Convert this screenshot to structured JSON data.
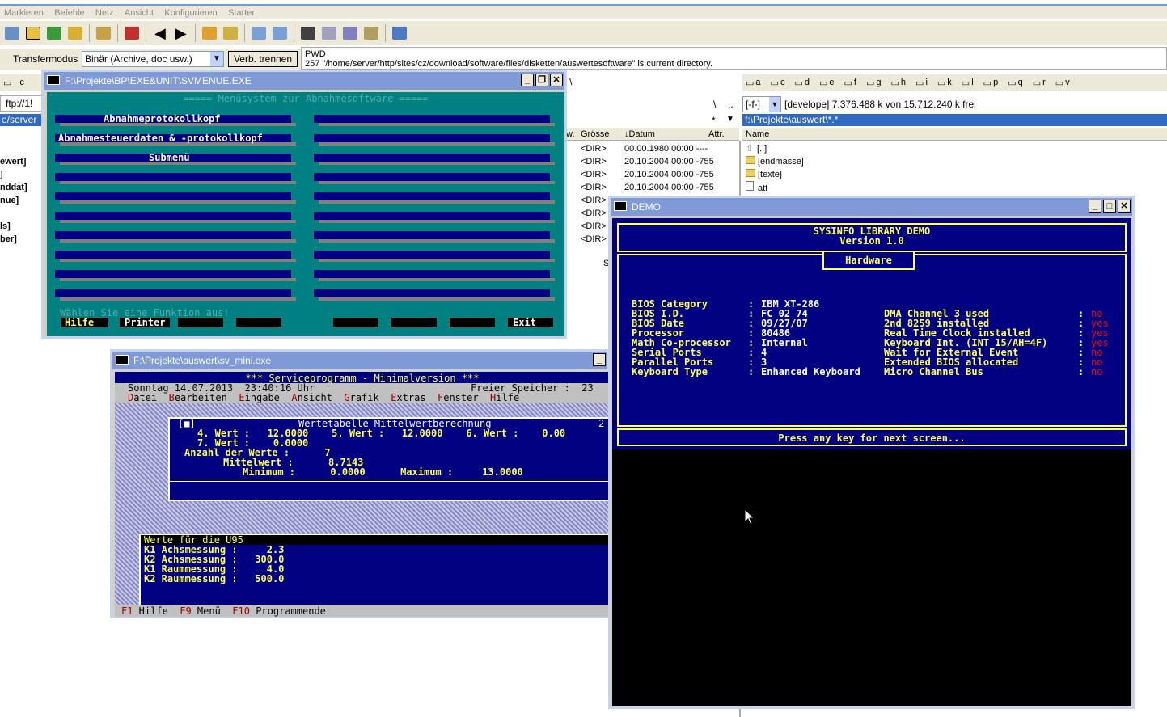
{
  "menubar": [
    "Markieren",
    "Befehle",
    "Netz",
    "Ansicht",
    "Konfigurieren",
    "Starter"
  ],
  "transfer": {
    "label": "Transfermodus",
    "mode": "Binär (Archive, doc usw.)",
    "disconnect": "Verb. trennen"
  },
  "ftp": {
    "pwd": "PWD",
    "msg": "257 \"/home/server/http/sites/cz/download/software/files/disketten/auswertesoftware\" is current directory."
  },
  "left_panel": {
    "drives": [
      "c"
    ],
    "path": "ftp://1!",
    "path2": "e/server",
    "items": [
      "ewert]",
      "]",
      "nddat]",
      "nue]",
      "ls]",
      "ber]"
    ]
  },
  "right_panel": {
    "drives": [
      "a",
      "c",
      "d",
      "e",
      "f",
      "g",
      "h",
      "i",
      "k",
      "l",
      "p",
      "q",
      "r",
      "v"
    ],
    "drive_sel": "[-f-]",
    "info": "[develope]  7.376.488 k von 15.712.240 k frei",
    "path": "f:\\Projekte\\auswert\\*.*",
    "name_header": "Name",
    "files": [
      "[..]",
      "[endmasse]",
      "[texte]",
      "att"
    ]
  },
  "mid_panel": {
    "backslash": "\\",
    "dots": "..",
    "star": "*",
    "cols": {
      "size": "Grösse",
      "date": "↓Datum",
      "attr": "Attr.",
      "w": "w."
    },
    "rows": [
      {
        "size": "<DIR>",
        "date": "00.00.1980 00:00 ----"
      },
      {
        "size": "<DIR>",
        "date": "20.10.2004 00:00 -755"
      },
      {
        "size": "<DIR>",
        "date": "20.10.2004 00:00 -755"
      },
      {
        "size": "<DIR>",
        "date": "20.10.2004 00:00 -755"
      },
      {
        "size": "<DIR>",
        "date": ""
      },
      {
        "size": "<DIR>",
        "date": ""
      },
      {
        "size": "<DIR>",
        "date": ""
      },
      {
        "size": "<DIR>",
        "date": ""
      }
    ],
    "s": "S"
  },
  "svmenue": {
    "title": "F:\\Projekte\\BP\\EXE&UNIT\\SVMENUE.EXE",
    "header": "===== Menüsystem zur Abnahmesoftware =====",
    "items": [
      "Abnahmeprotokollkopf",
      "Abnahmesteuerdaten & -protokollkopf",
      "Submenü"
    ],
    "prompt": "Wählen Sie eine Funktion aus!",
    "keys": {
      "hilfe": "Hilfe",
      "printer": "Printer",
      "exit": "Exit"
    }
  },
  "svmini": {
    "title": "F:\\Projekte\\auswert\\sv_mini.exe",
    "header": "*** Serviceprogramm - Minimalversion ***",
    "date_line": "Sonntag 14.07.2013  23:40:16 Uhr",
    "mem": "Freier Speicher :  23",
    "menu": [
      "Datei",
      "Bearbeiten",
      "Eingabe",
      "Ansicht",
      "Grafik",
      "Extras",
      "Fenster",
      "Hilfe"
    ],
    "table_title": "Wertetabelle Mittelwertberechnung",
    "tl_marker": "[■]",
    "tr_marker": "2",
    "rows": [
      "4. Wert :   12.0000    5. Wert :   12.0000    6. Wert :    0.00",
      "7. Wert :    0.0000"
    ],
    "anzahl": "Anzahl der Werte :      7",
    "mittel": "Mittelwert :      8.7143",
    "minmax": "Minimum :      0.0000      Maximum :     13.0000",
    "werte_title": "Werte für die U95",
    "werte": [
      "K1 Achsmessung :     2.3",
      "K2 Achsmessung :   300.0",
      "K1 Raummessung :     4.0",
      "K2 Raummessung :   500.0"
    ],
    "fkeys": [
      {
        "k": "F1",
        "t": " Hilfe"
      },
      {
        "k": "F9",
        "t": " Menü"
      },
      {
        "k": "F10",
        "t": " Programmende"
      }
    ]
  },
  "demo": {
    "title": "DEMO",
    "h1": "SYSINFO LIBRARY DEMO",
    "h2": "Version 1.0",
    "tab": "Hardware",
    "left": [
      [
        "BIOS Category",
        "IBM XT-286"
      ],
      [
        "BIOS I.D.",
        "FC 02 74"
      ],
      [
        "BIOS Date",
        "09/27/07"
      ],
      [
        "Processor",
        "80486"
      ],
      [
        "Math Co-processor",
        "Internal"
      ],
      [
        "Serial Ports",
        "4"
      ],
      [
        "Parallel Ports",
        "3"
      ],
      [
        "Keyboard Type",
        "Enhanced Keyboard"
      ]
    ],
    "right": [
      [
        "DMA Channel 3 used",
        "no"
      ],
      [
        "2nd 8259 installed",
        "yes"
      ],
      [
        "Real Time Clock installed",
        "yes"
      ],
      [
        "Keyboard Int. (INT 15/AH=4F)",
        "yes"
      ],
      [
        "Wait for External Event",
        "no"
      ],
      [
        "Extended BIOS allocated",
        "no"
      ],
      [
        "Micro Channel Bus",
        "no"
      ]
    ],
    "footer": "Press any key for next screen..."
  },
  "colors": {
    "dos_blue": "#000080",
    "dos_cyan": "#008080",
    "dos_yellow": "#ffff55",
    "dos_red": "#ff0000",
    "title_blue": "#7f9ad6"
  }
}
